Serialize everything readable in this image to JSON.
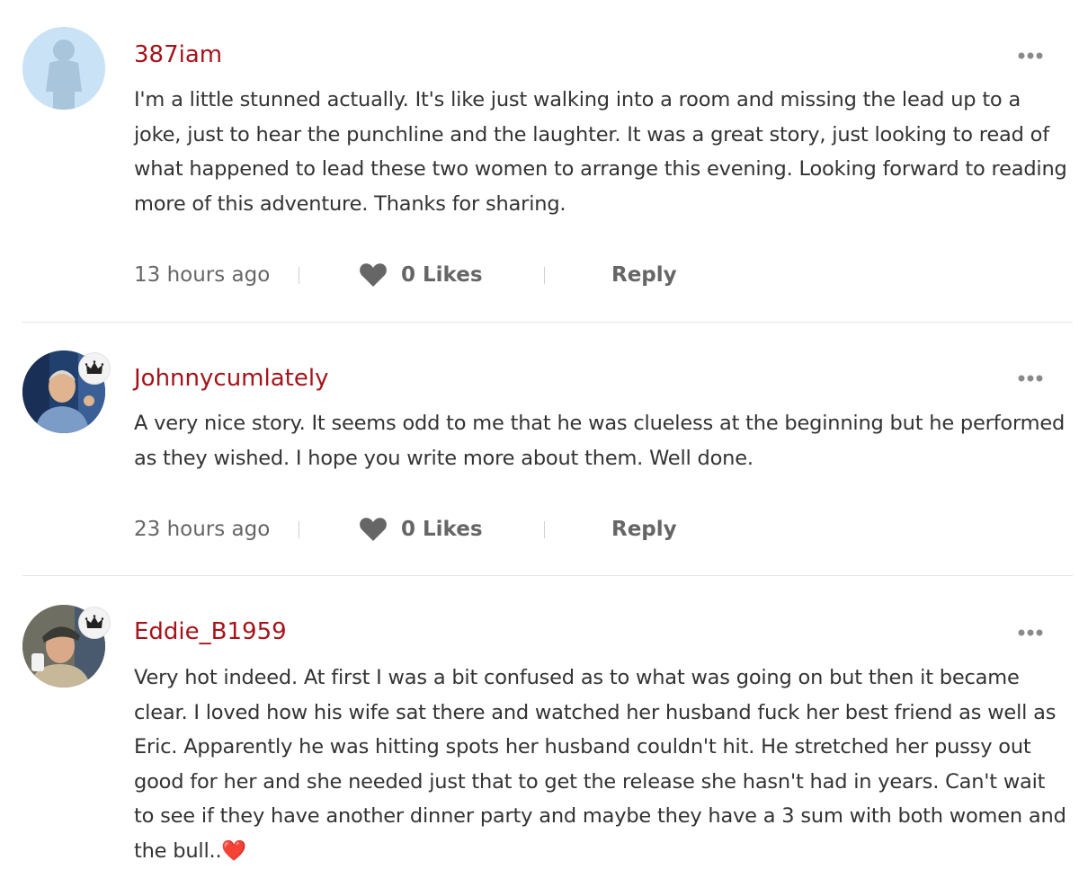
{
  "comments": [
    {
      "username": "387iam",
      "badge": "",
      "avatar_icon": "silhouette-avatar",
      "text": "I'm a little stunned actually. It's like just walking into a room and missing the lead up to a joke, just to hear the punchline and the laughter. It was a great story, just looking to read of what happened to lead these two women to arrange this evening. Looking forward to reading more of this adventure. Thanks for sharing.",
      "time": "13 hours ago",
      "likes": "0 Likes",
      "reply": "Reply"
    },
    {
      "username": "Johnnycumlately",
      "badge": "crown",
      "avatar_icon": "photo-avatar",
      "text": "A very nice story. It seems odd to me that he was clueless at the beginning but he performed as they wished. I hope you write more about them. Well done.",
      "time": "23 hours ago",
      "likes": "0 Likes",
      "reply": "Reply"
    },
    {
      "username": "Eddie_B1959",
      "badge": "crown",
      "avatar_icon": "photo-avatar",
      "text": "Very hot indeed. At first I was a bit confused as to what was going on but then it became clear. I loved how his wife sat there and watched her husband fuck her best friend as well as Eric. Apparently he was hitting spots her husband couldn't hit. He stretched her pussy out good for her and she needed just that to get the release she hasn't had in years. Can't wait to see if they have another dinner party and maybe they have a 3 sum with both women and the bull..❤️"
    }
  ],
  "colors": {
    "username": "#a5141a",
    "text": "#333333",
    "meta": "#666666",
    "divider": "#e4e4e4"
  }
}
